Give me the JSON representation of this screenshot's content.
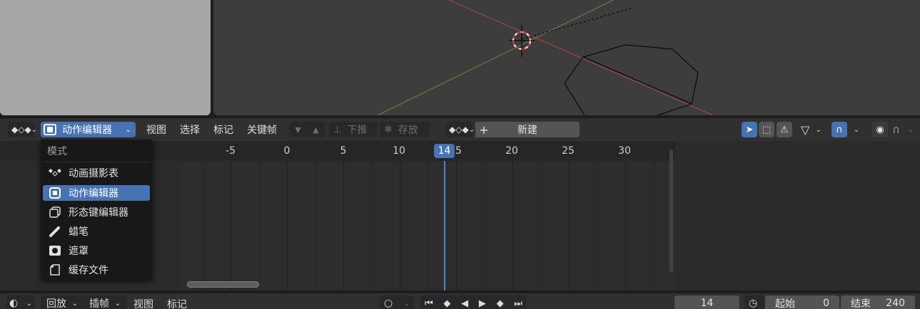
{
  "header": {
    "editor_type": "动作编辑器",
    "menu": [
      "视图",
      "选择",
      "标记",
      "关键帧"
    ],
    "push_down_label": "下推",
    "stash_label": "存放",
    "new_label": "新建",
    "new_plus": "+"
  },
  "timeline_ruler": {
    "ticks": [
      "-5",
      "0",
      "5",
      "10",
      "15",
      "20",
      "25",
      "30"
    ],
    "current_frame": "14"
  },
  "mode_dropdown": {
    "title": "模式",
    "items": [
      {
        "label": "动画摄影表",
        "icon": "dopesheet-icon"
      },
      {
        "label": "动作编辑器",
        "icon": "action-editor-icon",
        "selected": true
      },
      {
        "label": "形态键编辑器",
        "icon": "shape-key-icon"
      },
      {
        "label": "蜡笔",
        "icon": "grease-pencil-icon"
      },
      {
        "label": "遮罩",
        "icon": "mask-icon"
      },
      {
        "label": "缓存文件",
        "icon": "cache-file-icon"
      }
    ]
  },
  "bottom_bar": {
    "playback_label": "回放",
    "keying_label": "插帧",
    "view_label": "视图",
    "marker_label": "标记",
    "current_frame": "14",
    "start_label": "起始",
    "start_value": "0",
    "end_label": "结束",
    "end_value": "240"
  },
  "colors": {
    "accent": "#4772b3",
    "playhead": "#4a83d1",
    "x_axis": "#b8434f",
    "y_axis": "#6c8a33"
  }
}
